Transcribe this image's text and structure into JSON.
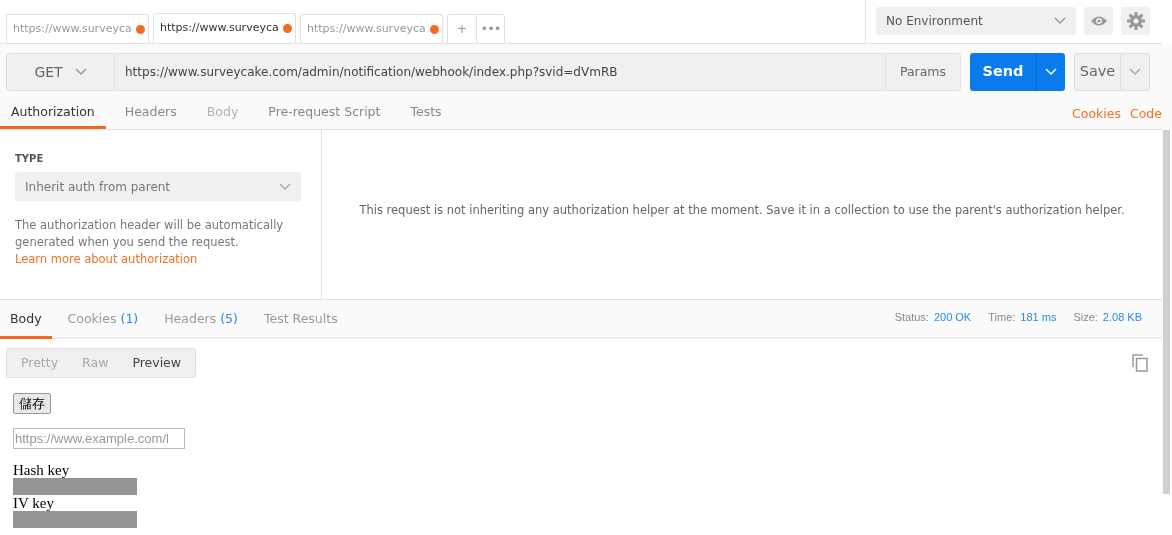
{
  "request_tabs": [
    {
      "label": "https://www.surveyca",
      "selected": false,
      "unsaved": true
    },
    {
      "label": "https://www.surveyca",
      "selected": true,
      "unsaved": true
    },
    {
      "label": "https://www.surveyca",
      "selected": false,
      "unsaved": true
    }
  ],
  "tab_actions": [
    "+",
    "•••"
  ],
  "environment": {
    "value": "No Environment"
  },
  "request": {
    "method": "GET",
    "url": "https://www.surveycake.com/admin/notification/webhook/index.php?svid=dVmRB",
    "params": "Params",
    "send": "Send",
    "save": "Save"
  },
  "request_sections": [
    {
      "label": "Authorization",
      "selected": true,
      "disabled": false
    },
    {
      "label": "Headers",
      "selected": false,
      "disabled": false
    },
    {
      "label": "Body",
      "selected": false,
      "disabled": true
    },
    {
      "label": "Pre-request Script",
      "selected": false,
      "disabled": false
    },
    {
      "label": "Tests",
      "selected": false,
      "disabled": false
    }
  ],
  "section_links": [
    "Cookies",
    "Code"
  ],
  "auth": {
    "type_label": "TYPE",
    "type_value": "Inherit auth from parent",
    "description": "The authorization header will be automatically generated when you send the request.",
    "link": "Learn more about authorization",
    "message": "This request is not inheriting any authorization helper at the moment. Save it in a collection to use the parent's authorization helper."
  },
  "response_tabs": [
    {
      "label": "Body",
      "selected": true
    },
    {
      "label": "Cookies",
      "count": "(1)",
      "selected": false
    },
    {
      "label": "Headers",
      "count": "(5)",
      "selected": false
    },
    {
      "label": "Test Results",
      "selected": false
    }
  ],
  "response_meta": [
    {
      "label": "Status:",
      "value": "200 OK"
    },
    {
      "label": "Time:",
      "value": "181 ms"
    },
    {
      "label": "Size:",
      "value": "2.08 KB"
    }
  ],
  "view_modes": [
    {
      "label": "Pretty",
      "selected": false
    },
    {
      "label": "Raw",
      "selected": false
    },
    {
      "label": "Preview",
      "selected": true
    }
  ],
  "preview": {
    "button": "儲存",
    "placeholder": "https://www.example.com/l",
    "fields": [
      {
        "label": "Hash key"
      },
      {
        "label": "IV key"
      }
    ]
  }
}
